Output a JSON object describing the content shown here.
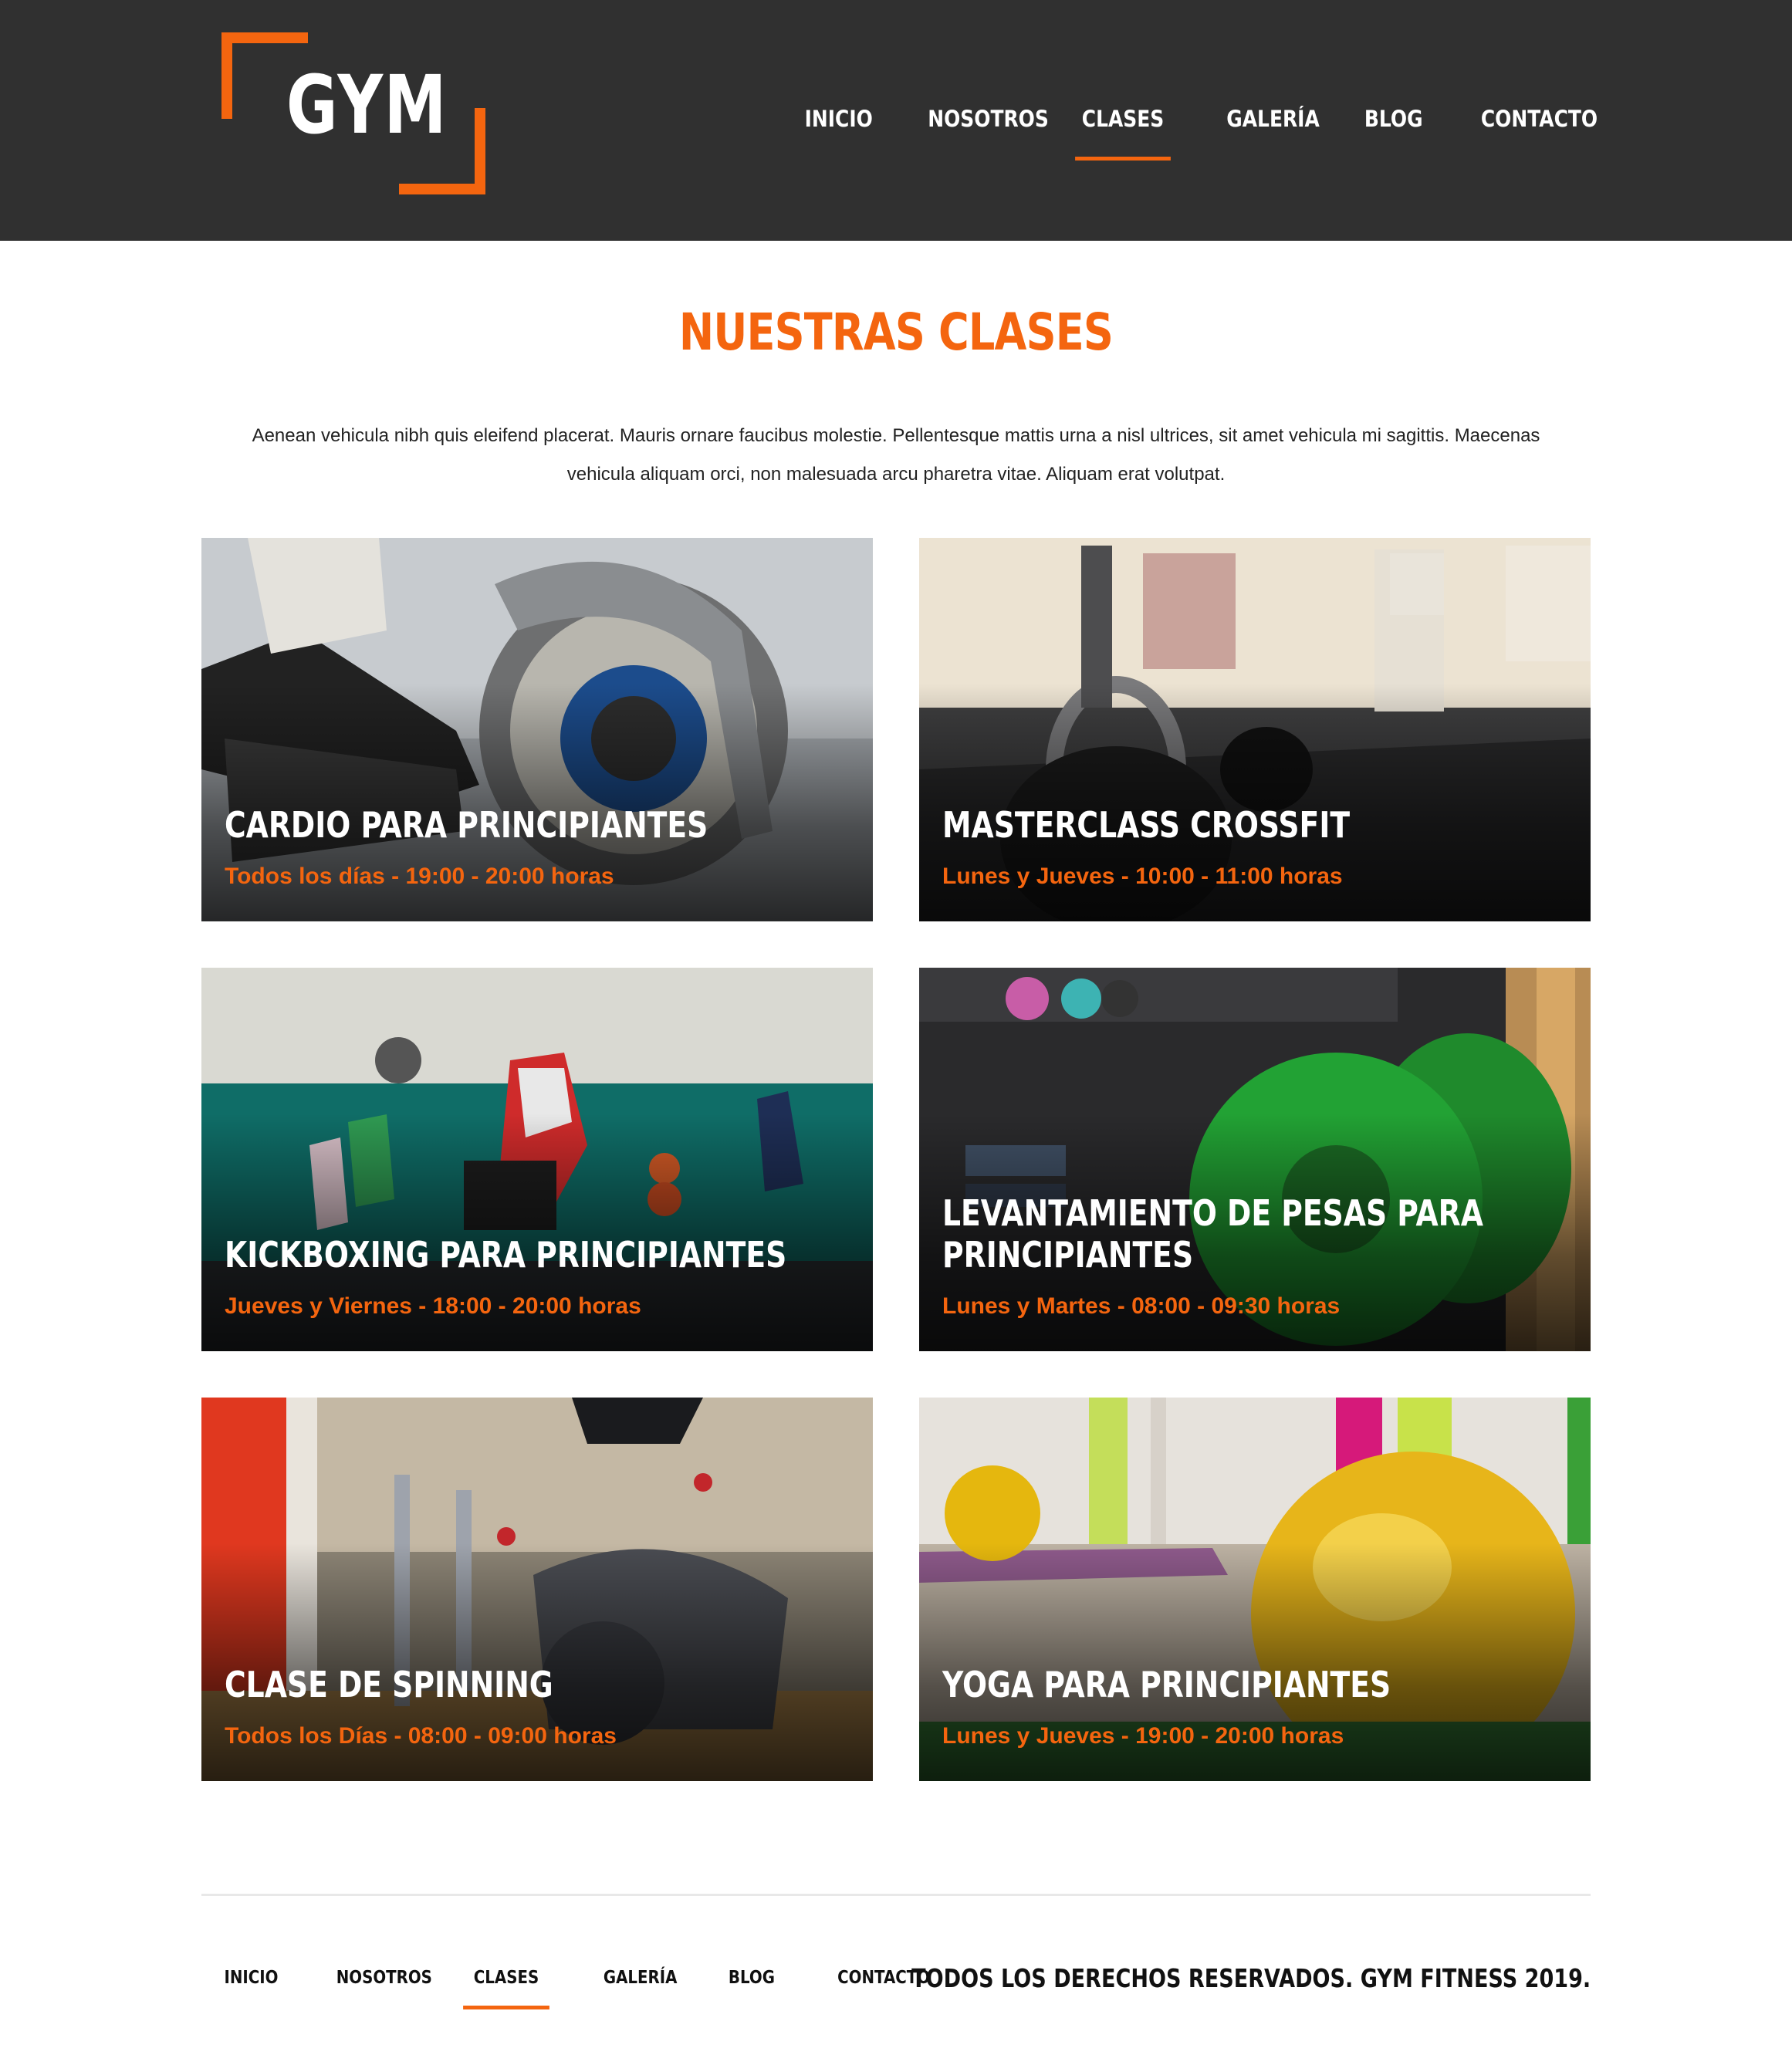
{
  "brand": {
    "logo_text": "GYM",
    "accent": "#f4650f",
    "header_bg": "#303030"
  },
  "nav": {
    "items": [
      {
        "label": "INICIO"
      },
      {
        "label": "NOSOTROS"
      },
      {
        "label": "CLASES"
      },
      {
        "label": "GALERÍA"
      },
      {
        "label": "BLOG"
      },
      {
        "label": "CONTACTO"
      }
    ],
    "active": "CLASES"
  },
  "main": {
    "title": "NUESTRAS CLASES",
    "intro": "Aenean vehicula nibh quis eleifend placerat. Mauris ornare faucibus molestie. Pellentesque mattis urna a nisl ultrices, sit amet vehicula mi sagittis. Maecenas vehicula aliquam orci, non malesuada arcu pharetra vitae. Aliquam erat volutpat.",
    "classes": [
      {
        "title": "CARDIO PARA PRINCIPIANTES",
        "schedule": "Todos los días - 19:00 - 20:00 horas",
        "image": "stationary-bike-photo"
      },
      {
        "title": "MASTERCLASS CROSSFIT",
        "schedule": "Lunes y Jueves - 10:00 - 11:00 horas",
        "image": "kettlebell-photo"
      },
      {
        "title": "KICKBOXING PARA PRINCIPIANTES",
        "schedule": "Jueves y Viernes - 18:00 - 20:00 horas",
        "image": "kickboxing-class-photo"
      },
      {
        "title": "LEVANTAMIENTO DE PESAS PARA PRINCIPIANTES",
        "schedule": "Lunes y Martes - 08:00 - 09:30 horas",
        "image": "weight-plates-photo"
      },
      {
        "title": "CLASE DE SPINNING",
        "schedule": "Todos los Días - 08:00 - 09:00 horas",
        "image": "spinning-bikes-photo"
      },
      {
        "title": "YOGA PARA PRINCIPIANTES",
        "schedule": "Lunes y Jueves - 19:00 - 20:00 horas",
        "image": "yoga-ball-photo"
      }
    ]
  },
  "footer": {
    "nav": [
      {
        "label": "INICIO"
      },
      {
        "label": "NOSOTROS"
      },
      {
        "label": "CLASES"
      },
      {
        "label": "GALERÍA"
      },
      {
        "label": "BLOG"
      },
      {
        "label": "CONTACTO"
      }
    ],
    "copyright": "TODOS LOS DERECHOS RESERVADOS. GYM FITNESS 2019."
  }
}
